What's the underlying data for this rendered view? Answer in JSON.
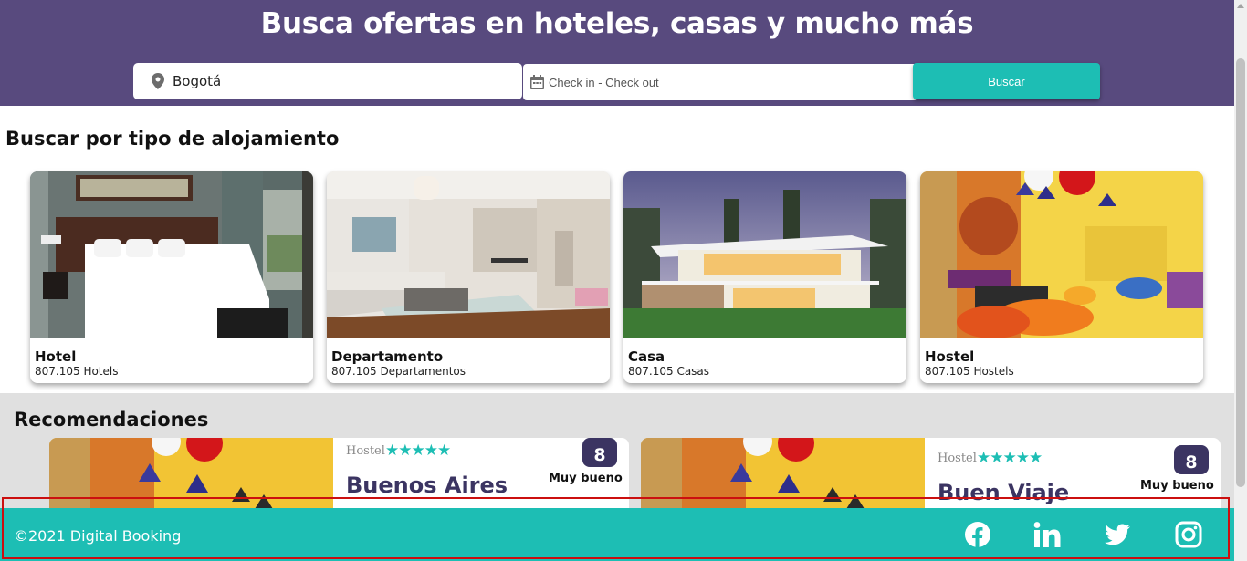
{
  "header": {
    "title": "Busca ofertas en hoteles, casas y mucho más",
    "background_color": "#584a7e"
  },
  "search": {
    "location_value": "Bogotá",
    "location_icon": "map-pin-icon",
    "date_placeholder": "Check in - Check out",
    "date_icon": "calendar-icon",
    "button_label": "Buscar",
    "accent_color": "#1dbeb4"
  },
  "categories": {
    "title": "Buscar por tipo de alojamiento",
    "items": [
      {
        "name": "Hotel",
        "count": "807.105 Hotels"
      },
      {
        "name": "Departamento",
        "count": "807.105 Departamentos"
      },
      {
        "name": "Casa",
        "count": "807.105 Casas"
      },
      {
        "name": "Hostel",
        "count": "807.105 Hostels"
      }
    ]
  },
  "recommendations": {
    "title": "Recomendaciones",
    "items": [
      {
        "category": "Hostel",
        "stars": "★★★★★",
        "title": "Buenos Aires",
        "score": "8",
        "rating_label": "Muy bueno"
      },
      {
        "category": "Hostel",
        "stars": "★★★★★",
        "title": "Buen Viaje",
        "score": "8",
        "rating_label": "Muy bueno"
      }
    ]
  },
  "footer": {
    "copyright": "©2021 Digital Booking",
    "social_icons": [
      "facebook-icon",
      "linkedin-icon",
      "twitter-icon",
      "instagram-icon"
    ],
    "background_color": "#1dbeb4"
  }
}
